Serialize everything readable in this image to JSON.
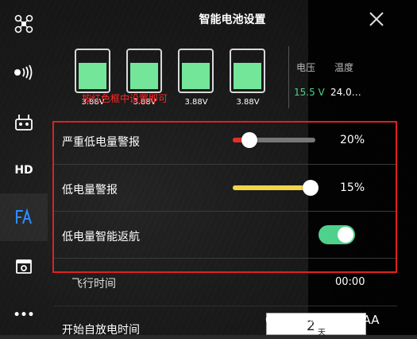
{
  "title": "智能电池设置",
  "sidebar": {
    "items": [
      {
        "icon": "drone-icon"
      },
      {
        "icon": "signal-icon"
      },
      {
        "icon": "remote-controller-icon"
      },
      {
        "label": "HD"
      },
      {
        "icon": "battery-fa-icon"
      },
      {
        "icon": "camera-icon"
      },
      {
        "label": "•••"
      }
    ]
  },
  "cells": [
    {
      "voltage": "3.88V",
      "fill": 0.72
    },
    {
      "voltage": "3.88V",
      "fill": 0.72
    },
    {
      "voltage": "3.88V",
      "fill": 0.72
    },
    {
      "voltage": "3.88V",
      "fill": 0.72
    }
  ],
  "hint": "按红色框中设置即可",
  "stats": {
    "voltage_label": "电压",
    "temp_label": "温度",
    "voltage_value": "15.5 V",
    "temp_value": "24.0…"
  },
  "settings": {
    "critical_low": {
      "label": "严重低电量警报",
      "value": "20%",
      "level": 0.2
    },
    "low": {
      "label": "低电量警报",
      "value": "15%",
      "level": 0.94
    },
    "smart_rth": {
      "label": "低电量智能返航",
      "enabled": true
    }
  },
  "flight_time": {
    "label": "飞行时间",
    "value": "00:00"
  },
  "self_discharge": {
    "label": "开始自放电时间",
    "value": "2",
    "unit": "天"
  },
  "watermark": "CSDN @一别如斯AA",
  "colors": {
    "accent_blue": "#2f8cff",
    "cell_green": "#74e69a",
    "voltage_green": "#4fd18b",
    "critical_red": "#e0302a",
    "low_yellow": "#f2d44a",
    "highlight_red": "#e02020"
  }
}
